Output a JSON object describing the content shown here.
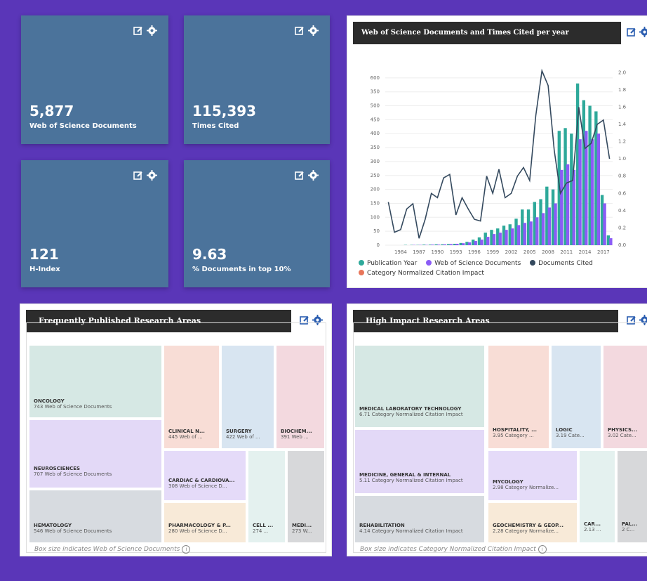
{
  "tiles": [
    {
      "value": "5,877",
      "label": "Web of Science Documents"
    },
    {
      "value": "115,393",
      "label": "Times Cited"
    },
    {
      "value": "121",
      "label": "H-Index"
    },
    {
      "value": "9.63",
      "label": "% Documents in top 10%"
    }
  ],
  "chart_panel": {
    "title": "Web of Science Documents and Times Cited per year",
    "legend": [
      "Publication Year",
      "Web of Science Documents",
      "Documents Cited",
      "Category Normalized Citation Impact"
    ]
  },
  "colors": {
    "teal": "#2ea99a",
    "purple": "#8b5cf6",
    "navy": "#34495e",
    "orange": "#e8765a",
    "tile": "#4b739b"
  },
  "chart_data": {
    "type": "bar",
    "x_ticks": [
      "1984",
      "1987",
      "1990",
      "1993",
      "1996",
      "1999",
      "2002",
      "2005",
      "2008",
      "2011",
      "2014",
      "2017"
    ],
    "left_ticks": [
      "0",
      "50",
      "100",
      "150",
      "200",
      "250",
      "300",
      "350",
      "400",
      "450",
      "500",
      "350",
      "600"
    ],
    "right_ticks": [
      "0.0",
      "0.2",
      "0.4",
      "0.6",
      "0.8",
      "1.0",
      "1.2",
      "1.4",
      "1.6",
      "1.8",
      "2.0"
    ],
    "years": [
      1982,
      1983,
      1984,
      1985,
      1986,
      1987,
      1988,
      1989,
      1990,
      1991,
      1992,
      1993,
      1994,
      1995,
      1996,
      1997,
      1998,
      1999,
      2000,
      2001,
      2002,
      2003,
      2004,
      2005,
      2006,
      2007,
      2008,
      2009,
      2010,
      2011,
      2012,
      2013,
      2014,
      2015,
      2016,
      2017,
      2018
    ],
    "series": [
      {
        "name": "Publication Year",
        "values": [
          0,
          0,
          0,
          1,
          1,
          1,
          2,
          2,
          3,
          3,
          4,
          5,
          8,
          12,
          20,
          28,
          45,
          55,
          60,
          70,
          75,
          95,
          128,
          128,
          155,
          165,
          210,
          200,
          410,
          420,
          400,
          580,
          520,
          500,
          480,
          180,
          35
        ]
      },
      {
        "name": "Web of Science Documents",
        "values": [
          0,
          0,
          0,
          0,
          1,
          1,
          1,
          2,
          2,
          3,
          4,
          5,
          7,
          10,
          15,
          20,
          30,
          40,
          45,
          55,
          60,
          72,
          80,
          85,
          100,
          115,
          135,
          150,
          270,
          290,
          270,
          380,
          410,
          380,
          400,
          150,
          25
        ]
      },
      {
        "name": "Documents Cited",
        "values": [
          0.5,
          0.15,
          0.18,
          0.42,
          0.48,
          0.08,
          0.3,
          0.6,
          0.55,
          0.78,
          0.82,
          0.35,
          0.55,
          0.42,
          0.3,
          0.28,
          0.8,
          0.6,
          0.88,
          0.55,
          0.6,
          0.8,
          0.9,
          0.75,
          1.5,
          2.02,
          1.85,
          1.1,
          0.6,
          0.72,
          0.75,
          1.6,
          1.12,
          1.18,
          1.4,
          1.45,
          1.0
        ]
      }
    ]
  },
  "research_areas": {
    "title": "Frequently Published Research Areas",
    "caption": "Box size indicates Web of Science Documents",
    "items": [
      {
        "t": "ONCOLOGY",
        "v": "743 Web of Science Documents"
      },
      {
        "t": "NEUROSCIENCES",
        "v": "707 Web of Science Documents"
      },
      {
        "t": "HEMATOLOGY",
        "v": "546 Web of Science Documents"
      },
      {
        "t": "CLINICAL N...",
        "v": "445 Web of ..."
      },
      {
        "t": "SURGERY",
        "v": "422 Web of ..."
      },
      {
        "t": "BIOCHEM...",
        "v": "391 Web ..."
      },
      {
        "t": "CARDIAC & CARDIOVA...",
        "v": "308 Web of Science D..."
      },
      {
        "t": "PHARMACOLOGY & P...",
        "v": "280 Web of Science D..."
      },
      {
        "t": "CELL ...",
        "v": "274 ..."
      },
      {
        "t": "MEDI...",
        "v": "273 W..."
      }
    ]
  },
  "high_impact": {
    "title": "High Impact Research Areas",
    "caption": "Box size indicates Category Normalized Citation Impact",
    "items": [
      {
        "t": "MEDICAL LABORATORY TECHNOLOGY",
        "v": "6.71 Category Normalized Citation Impact"
      },
      {
        "t": "MEDICINE, GENERAL & INTERNAL",
        "v": "5.11 Category Normalized Citation Impact"
      },
      {
        "t": "REHABILITATION",
        "v": "4.14 Category Normalized Citation Impact"
      },
      {
        "t": "HOSPITALITY, ...",
        "v": "3.95 Category ..."
      },
      {
        "t": "LOGIC",
        "v": "3.19 Cate..."
      },
      {
        "t": "PHYSICS...",
        "v": "3.02 Cate..."
      },
      {
        "t": "MYCOLOGY",
        "v": "2.98 Category Normalize..."
      },
      {
        "t": "GEOCHEMISTRY & GEOP...",
        "v": "2.28 Category Normalize..."
      },
      {
        "t": "CAR...",
        "v": "2.13 ..."
      },
      {
        "t": "PAL...",
        "v": "2 C..."
      }
    ]
  }
}
